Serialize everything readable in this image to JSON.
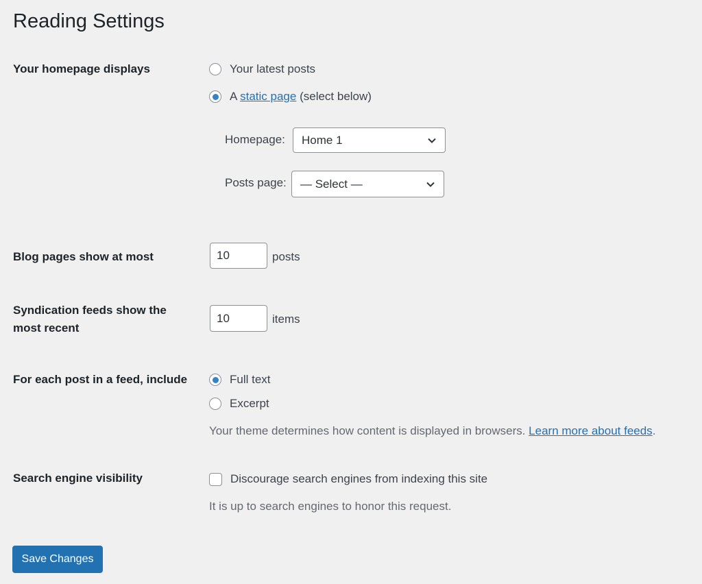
{
  "page": {
    "title": "Reading Settings"
  },
  "homepage_displays": {
    "label": "Your homepage displays",
    "options": [
      {
        "label": "Your latest posts",
        "checked": false
      },
      {
        "prefix": "A ",
        "link_text": "static page",
        "suffix": " (select below)",
        "checked": true
      }
    ],
    "homepage": {
      "label": "Homepage:",
      "value": "Home 1"
    },
    "posts_page": {
      "label": "Posts page:",
      "value": "— Select —"
    }
  },
  "blog_pages": {
    "label": "Blog pages show at most",
    "value": "10",
    "unit": "posts"
  },
  "syndication": {
    "label_line1": "Syndication feeds show the",
    "label_line2": "most recent",
    "value": "10",
    "unit": "items"
  },
  "feed_include": {
    "label": "For each post in a feed, include",
    "options": [
      {
        "label": "Full text",
        "checked": true
      },
      {
        "label": "Excerpt",
        "checked": false
      }
    ],
    "description": "Your theme determines how content is displayed in browsers. ",
    "link_text": "Learn more about feeds",
    "description_end": "."
  },
  "search_visibility": {
    "label": "Search engine visibility",
    "checkbox_label": "Discourage search engines from indexing this site",
    "checked": false,
    "description": "It is up to search engines to honor this request."
  },
  "actions": {
    "save_label": "Save Changes"
  },
  "colors": {
    "accent": "#2271b1",
    "radio_dot": "#3582c4",
    "background": "#f0f0f1"
  }
}
